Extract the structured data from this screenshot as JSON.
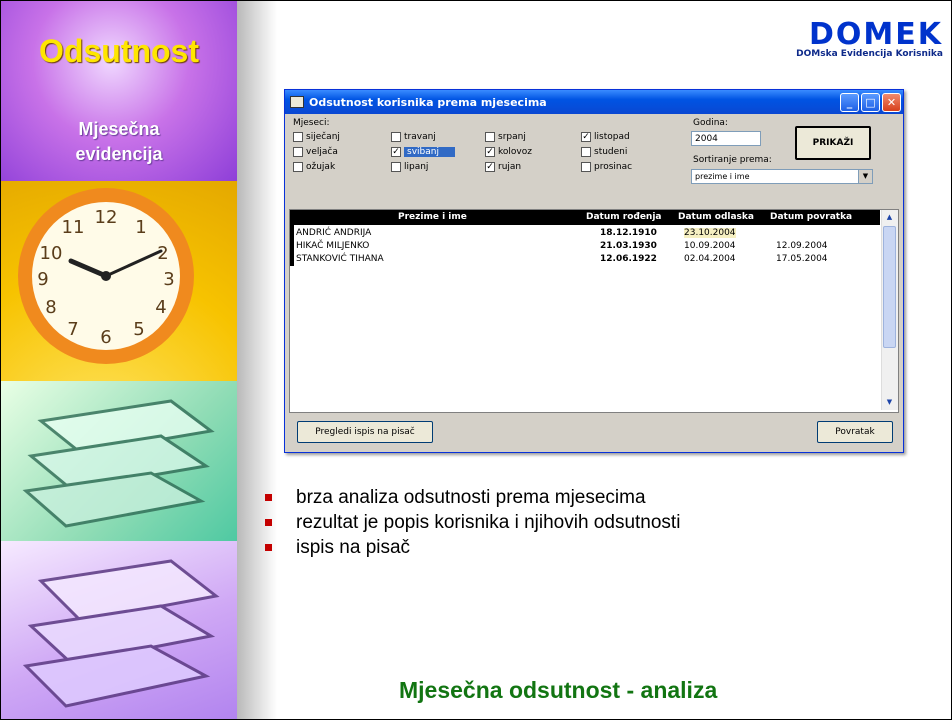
{
  "slide": {
    "title": "Odsutnost",
    "subtitle_line1": "Mjesečna",
    "subtitle_line2": "evidencija",
    "footer": "Mjesečna odsutnost - analiza",
    "bullets": [
      "brza analiza odsutnosti prema mjesecima",
      "rezultat je popis korisnika i njihovih odsutnosti",
      "ispis na pisač"
    ]
  },
  "logo": {
    "name": "DOMEK",
    "tagline": "DOMska Evidencija Korisnika"
  },
  "window": {
    "title": "Odsutnost korisnika prema mjesecima",
    "months_label": "Mjeseci:",
    "months": [
      {
        "label": "siječanj",
        "checked": false
      },
      {
        "label": "travanj",
        "checked": false
      },
      {
        "label": "srpanj",
        "checked": false
      },
      {
        "label": "listopad",
        "checked": true
      },
      {
        "label": "veljača",
        "checked": false
      },
      {
        "label": "svibanj",
        "checked": true
      },
      {
        "label": "kolovoz",
        "checked": true
      },
      {
        "label": "studeni",
        "checked": false
      },
      {
        "label": "ožujak",
        "checked": false
      },
      {
        "label": "lipanj",
        "checked": false
      },
      {
        "label": "rujan",
        "checked": true
      },
      {
        "label": "prosinac",
        "checked": false
      }
    ],
    "year_label": "Godina:",
    "year_value": "2004",
    "show_button": "PRIKAŽI",
    "sort_label": "Sortiranje prema:",
    "sort_value": "prezime i ime",
    "columns": [
      "Prezime i ime",
      "Datum rođenja",
      "Datum odlaska",
      "Datum povratka"
    ],
    "rows": [
      {
        "name": "ANDRIĆ ANDRIJA",
        "dob": "18.12.1910",
        "leave": "23.10.2004",
        "return": ""
      },
      {
        "name": "HIKAČ MILJENKO",
        "dob": "21.03.1930",
        "leave": "10.09.2004",
        "return": "12.09.2004"
      },
      {
        "name": "STANKOVIĆ TIHANA",
        "dob": "12.06.1922",
        "leave": "02.04.2004",
        "return": "17.05.2004"
      }
    ],
    "print_button": "Pregledi ispis na pisač",
    "back_button": "Povratak"
  }
}
